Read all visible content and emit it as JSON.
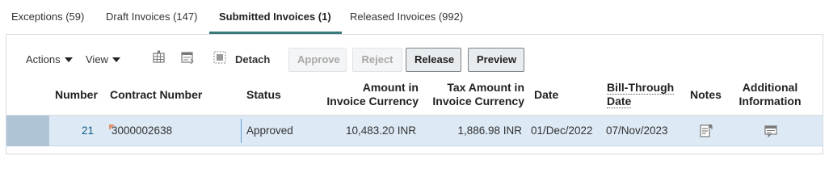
{
  "tabs": [
    {
      "label": "Exceptions (59)"
    },
    {
      "label": "Draft Invoices (147)"
    },
    {
      "label": "Submitted Invoices (1)"
    },
    {
      "label": "Released Invoices (992)"
    }
  ],
  "toolbar": {
    "actions_label": "Actions",
    "view_label": "View",
    "detach_label": "Detach",
    "approve_label": "Approve",
    "reject_label": "Reject",
    "release_label": "Release",
    "preview_label": "Preview"
  },
  "table": {
    "headers": {
      "number": "Number",
      "contract_number": "Contract Number",
      "status": "Status",
      "amount_line1": "Amount in",
      "amount_line2": "Invoice Currency",
      "tax_line1": "Tax Amount in",
      "tax_line2": "Invoice Currency",
      "date": "Date",
      "bill_through_line1": "Bill-Through",
      "bill_through_line2": "Date",
      "notes": "Notes",
      "additional_line1": "Additional",
      "additional_line2": "Information"
    },
    "rows": [
      {
        "number": "21",
        "contract_number": "3000002638",
        "status": "Approved",
        "amount": "10,483.20 INR",
        "tax_amount": "1,886.98 INR",
        "date": "01/Dec/2022",
        "bill_through_date": "07/Nov/2023"
      }
    ]
  },
  "icons": {
    "freeze": "freeze-columns-icon",
    "wrap": "wrap-icon",
    "detach": "detach-icon",
    "notes": "notes-icon",
    "additional": "additional-info-icon"
  },
  "colors": {
    "active_tab_underline": "#3a7a7a",
    "row_highlight": "#dde9f5",
    "link": "#0e5c82",
    "flag": "#e0926d"
  }
}
